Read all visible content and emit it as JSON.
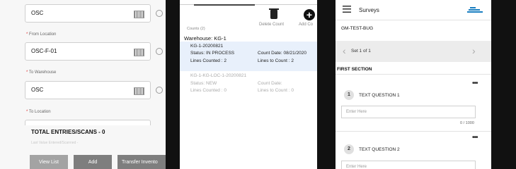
{
  "receiving": {
    "field_top_value": "OSC",
    "from_location_label": "From Location",
    "from_location_value": "OSC-F-01",
    "to_warehouse_label": "To Warehouse",
    "to_warehouse_value": "OSC",
    "to_location_label": "To Location",
    "required_mark": "*",
    "total_label": "TOTAL ENTRIES/SCANS - 0",
    "last_value_label": "Last Value Entered/Scanned -",
    "buttons": {
      "view_list": "View List",
      "add": "Add",
      "transfer": "Transfer Invento"
    }
  },
  "counts": {
    "delete_count_label": "Delete Count",
    "add_count_label": "Add Co",
    "counts_label": "Counts (2)",
    "warehouse_label": "Warehouse: KG-1",
    "items": [
      {
        "id": "KG-1-20200821",
        "status": "Status: IN PROCESS",
        "count_date": "Count Date: 08/21/2020",
        "lines_counted": "Lines Counted : 2",
        "lines_to_count": "Lines to Count : 2"
      },
      {
        "id": "KG-1-KG-LOC-1-20200821",
        "status": "Status: NEW",
        "count_date": "Count Date:",
        "lines_counted": "Lines Counted : 0",
        "lines_to_count": "Lines to Count : 0"
      }
    ]
  },
  "surveys": {
    "title": "Surveys",
    "survey_name": "GM-TEST-BUG",
    "set_label": "Set 1 of 1",
    "section_title": "FIRST SECTION",
    "questions": [
      {
        "number": "1",
        "text": "TEXT QUESTION 1",
        "placeholder": "Enter Here",
        "counter": "0 / 1000"
      },
      {
        "number": "2",
        "text": "TEXT QUESTION 2",
        "placeholder": "Enter Here"
      }
    ],
    "more_icon": "•••",
    "prev_arrow": "‹",
    "next_arrow": "›"
  },
  "colors": {
    "button_bg": "#8e8e8e",
    "highlight": "#e8f0fb",
    "logo": "#1a7fc1"
  }
}
